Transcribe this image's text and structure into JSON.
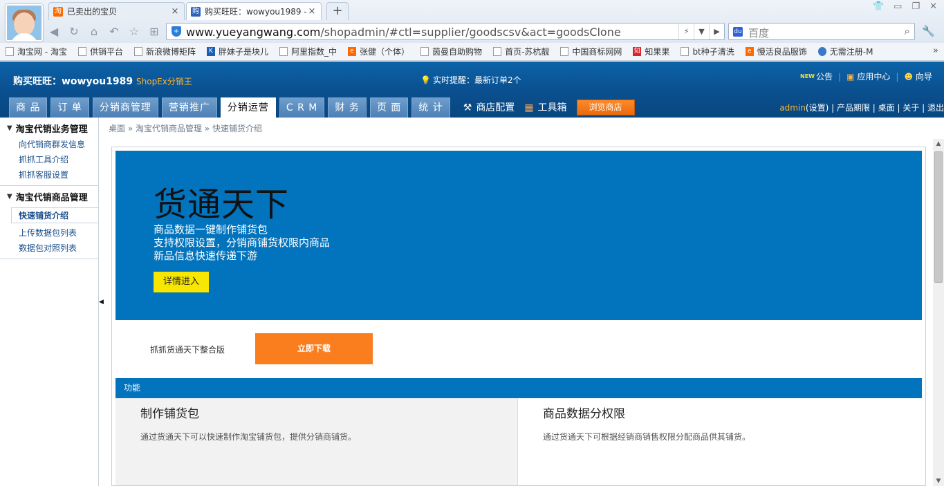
{
  "browser": {
    "tabs": [
      {
        "label": "已卖出的宝贝",
        "icon": "淘"
      },
      {
        "label": "购买旺旺：wowyou1989 -",
        "icon": "购"
      }
    ],
    "tab_close": "×",
    "new_tab": "+",
    "url_domain": "www.yueyangwang.com",
    "url_path": "/shopadmin/#ctl=supplier/goodscsv&act=goodsClone",
    "search_placeholder": "百度",
    "bookmarks": [
      "淘宝网 - 淘宝",
      "供销平台",
      "新浪微博矩阵",
      "胖妹子是块儿",
      "阿里指数_中",
      "张健（个体）",
      "茵曼自助购物",
      "首页-苏杭靓",
      "中国商标网网",
      "知果果",
      "bt种子清洗",
      "慢活良品服饰",
      "无需注册-M"
    ],
    "bookmarks_more": "»"
  },
  "header": {
    "shop_title": "购买旺旺：wowyou1989",
    "shop_sub": "ShopEx分销王",
    "alert_text": "实时提醒：最新订单2个",
    "links": {
      "notice_badge": "NEW",
      "notice": "公告",
      "app_center": "应用中心",
      "guide": "向导"
    },
    "menu": [
      "商 品",
      "订 单",
      "分销商管理",
      "营销推广",
      "分销运营",
      "C R M",
      "财 务",
      "页 面",
      "统 计"
    ],
    "active_menu": "分销运营",
    "tool_shop_config": "商店配置",
    "tool_toolbox": "工具箱",
    "browse_shop": "浏览商店",
    "user": {
      "admin": "admin",
      "settings": "(设置)",
      "rest": " | 产品期限 | 桌面 | 关于 | 退出"
    }
  },
  "sidebar": {
    "groups": [
      {
        "title": "淘宝代销业务管理",
        "items": [
          "向代销商群发信息",
          "抓抓工具介绍",
          "抓抓客服设置"
        ]
      },
      {
        "title": "淘宝代销商品管理",
        "current": "快速铺货介绍",
        "items": [
          "上传数据包列表",
          "数据包对照列表"
        ]
      }
    ]
  },
  "breadcrumb": "桌面 » 淘宝代销商品管理 » 快速铺货介绍",
  "hero": {
    "title": "货通天下",
    "lines": [
      "商品数据一键制作铺货包",
      "支持权限设置，分销商铺货权限内商品",
      "新品信息快速传递下游"
    ],
    "button": "详情进入"
  },
  "download": {
    "label": "抓抓货通天下整合版",
    "button": "立即下载"
  },
  "functions": {
    "bar_label": "功能",
    "features": [
      {
        "title": "制作铺货包",
        "desc": "通过货通天下可以快速制作淘宝铺货包，提供分销商铺货。"
      },
      {
        "title": "商品数据分权限",
        "desc": "通过货通天下可根据经销商销售权限分配商品供其铺货。"
      }
    ]
  },
  "colors": {
    "header_blue": "#0a4f8e",
    "hero_blue": "#0273bd",
    "accent_orange": "#fa7d1e",
    "button_yellow": "#f6e600"
  }
}
